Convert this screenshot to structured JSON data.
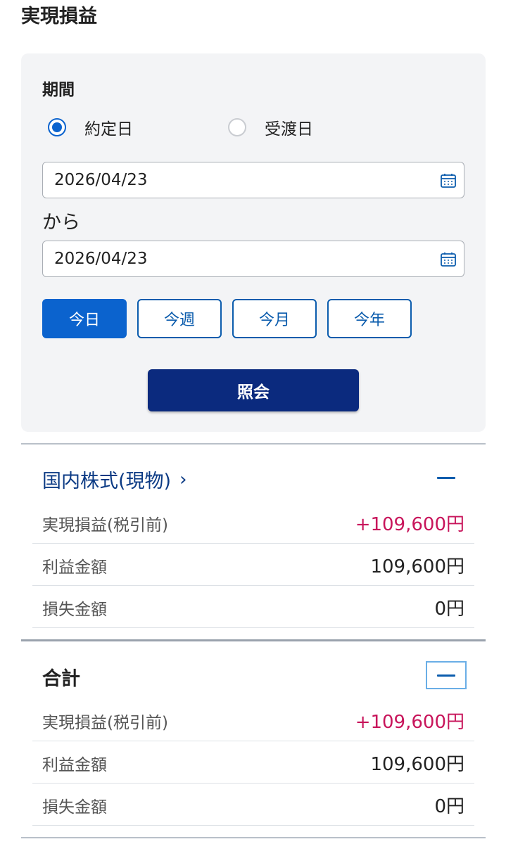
{
  "page": {
    "title": "実現損益"
  },
  "filter": {
    "period_label": "期間",
    "radio_yakujo": "約定日",
    "radio_ukewatashi": "受渡日",
    "date_from": "2026/04/23",
    "kara": "から",
    "date_to": "2026/04/23",
    "quick_today": "今日",
    "quick_week": "今週",
    "quick_month": "今月",
    "quick_year": "今年",
    "search_label": "照会"
  },
  "domestic": {
    "title": "国内株式(現物)",
    "chevron": "›",
    "realized_label": "実現損益(税引前)",
    "realized_value": "+109,600円",
    "profit_label": "利益金額",
    "profit_value": "109,600円",
    "loss_label": "損失金額",
    "loss_value": "0円"
  },
  "total": {
    "title": "合計",
    "realized_label": "実現損益(税引前)",
    "realized_value": "+109,600円",
    "profit_label": "利益金額",
    "profit_value": "109,600円",
    "loss_label": "損失金額",
    "loss_value": "0円"
  },
  "colors": {
    "accent_blue": "#0b63ce",
    "navy_button": "#0b2a7e",
    "profit_red": "#c8155b"
  }
}
